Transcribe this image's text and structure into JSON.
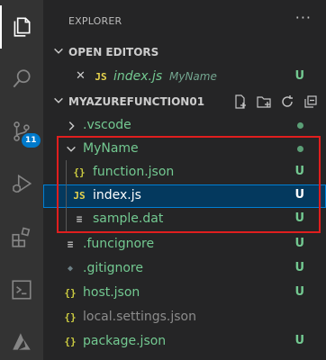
{
  "explorer": {
    "title": "EXPLORER",
    "more": "···"
  },
  "activity": {
    "scm_badge": "11"
  },
  "open_editors": {
    "title": "OPEN EDITORS",
    "items": [
      {
        "close": "✕",
        "icon": "JS",
        "name": "index.js",
        "folder": "MyName",
        "status": "U"
      }
    ]
  },
  "workspace": {
    "title": "MYAZUREFUNCTION01",
    "items": [
      {
        "name": ".vscode",
        "icon": "",
        "status": "",
        "color": "#73c991"
      },
      {
        "name": "MyName",
        "icon": "",
        "status": "",
        "color": "#73c991"
      },
      {
        "name": "function.json",
        "icon": "{}",
        "status": "U",
        "color": "#73c991"
      },
      {
        "name": "index.js",
        "icon": "JS",
        "status": "U",
        "color": "#ffffff"
      },
      {
        "name": "sample.dat",
        "icon": "≡",
        "status": "U",
        "color": "#73c991"
      },
      {
        "name": ".funcignore",
        "icon": "≡",
        "status": "U",
        "color": "#73c991"
      },
      {
        "name": ".gitignore",
        "icon": "◆",
        "status": "U",
        "color": "#73c991"
      },
      {
        "name": "host.json",
        "icon": "{}",
        "status": "U",
        "color": "#73c991"
      },
      {
        "name": "local.settings.json",
        "icon": "{}",
        "status": "",
        "color": "#8c8c8c"
      },
      {
        "name": "package.json",
        "icon": "{}",
        "status": "U",
        "color": "#73c991"
      }
    ]
  },
  "colors": {
    "untracked": "#73c991",
    "ignored": "#8c8c8c",
    "accent": "#007acc",
    "highlight": "#e01e1e"
  }
}
